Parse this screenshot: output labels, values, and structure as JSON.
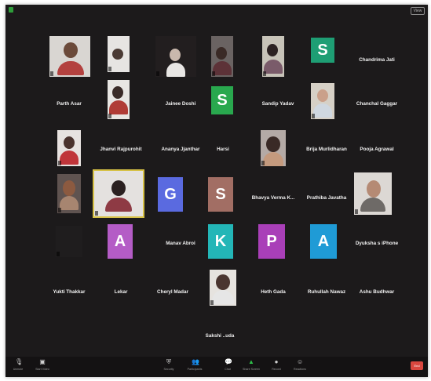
{
  "window": {
    "view_label": "View"
  },
  "colors": {
    "background": "#1c1a1b",
    "toolbar": "#141213",
    "active_speaker": "#d6c146",
    "end": "#d9473f"
  },
  "name_tiles": {
    "chandrima": "Chandrima Jati",
    "parth": "Parth Asar",
    "jainee": "Jainee Doshi",
    "sandip": "Sandip Yadav",
    "chanchal": "Chanchal Gaggar",
    "jhanvi": "Jhanvi Rajpurohit",
    "ananya": "Ananya Jjanthar",
    "harsi": "Harsi",
    "brija": "Brija Murlidharan",
    "pooja": "Pooja Agrawal",
    "bhavya": "Bhavya Verma K...",
    "prathiba": "Prathiba Javatha",
    "manav": "Manav Abroi",
    "dyuksha": "Dyuksha s iPhone",
    "yukti": "Yukti Thakkar",
    "lekar": "Lekar",
    "cheryl": "Cheryl Madar",
    "heth": "Heth Gada",
    "ruhullah": "Ruhullah Nawaz",
    "ashu": "Ashu Budhwar",
    "sakshi": "Sakshi ..uda"
  },
  "avatars": {
    "s1": "S",
    "s2": "S",
    "g": "G",
    "s3": "S",
    "a1": "A",
    "k": "K",
    "p": "P",
    "a2": "A"
  },
  "avatar_colors": {
    "s1": "#1e9e74",
    "s2": "#29a84e",
    "g": "#5a6ae0",
    "s3": "#a26e64",
    "a1": "#b45cc6",
    "k": "#23b6b7",
    "p": "#a93fb8",
    "a2": "#1f9bd6"
  },
  "toolbar": {
    "unmute": "Unmute",
    "start_video": "Start Video",
    "security": "Security",
    "participants": "Participants",
    "participant_count": "40",
    "chat": "Chat",
    "share_screen": "Share Screen",
    "record": "Record",
    "reactions": "Reactions",
    "end": "End"
  }
}
